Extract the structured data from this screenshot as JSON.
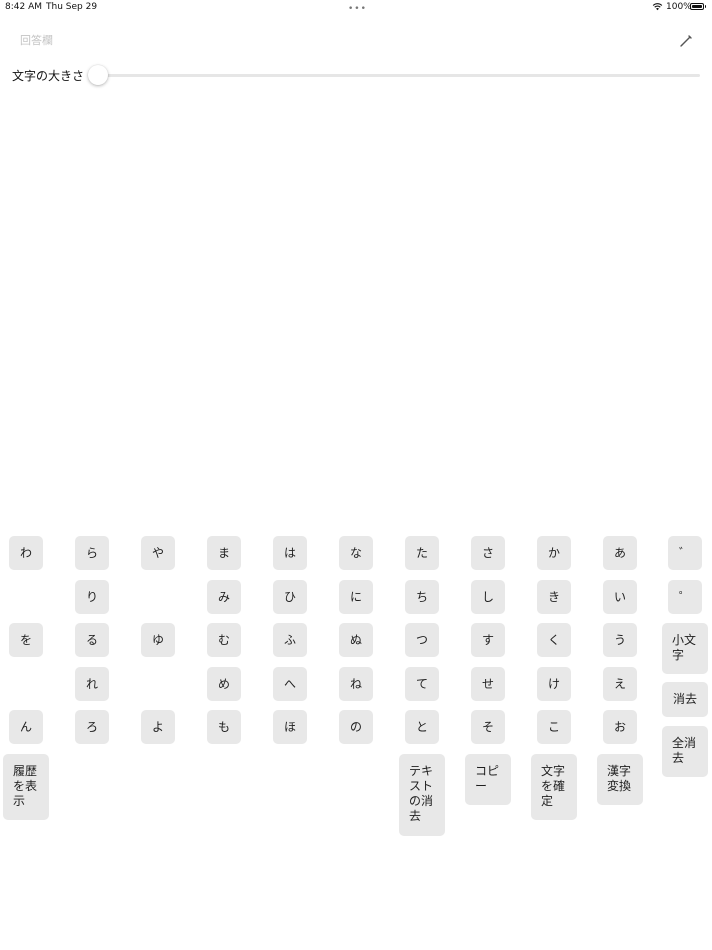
{
  "status_bar": {
    "time": "8:42 AM",
    "date": "Thu Sep 29",
    "battery": "100%"
  },
  "answer": {
    "placeholder": "回答欄",
    "value": ""
  },
  "font_size": {
    "label": "文字の大きさ",
    "value": 0
  },
  "keyboard": {
    "columns": [
      {
        "id": "wa",
        "keys": [
          "わ",
          "",
          "を",
          "",
          "ん"
        ]
      },
      {
        "id": "ra",
        "keys": [
          "ら",
          "り",
          "る",
          "れ",
          "ろ"
        ]
      },
      {
        "id": "ya",
        "keys": [
          "や",
          "",
          "ゆ",
          "",
          "よ"
        ]
      },
      {
        "id": "ma",
        "keys": [
          "ま",
          "み",
          "む",
          "め",
          "も"
        ]
      },
      {
        "id": "ha",
        "keys": [
          "は",
          "ひ",
          "ふ",
          "へ",
          "ほ"
        ]
      },
      {
        "id": "na",
        "keys": [
          "な",
          "に",
          "ぬ",
          "ね",
          "の"
        ]
      },
      {
        "id": "ta",
        "keys": [
          "た",
          "ち",
          "つ",
          "て",
          "と"
        ]
      },
      {
        "id": "sa",
        "keys": [
          "さ",
          "し",
          "す",
          "せ",
          "そ"
        ]
      },
      {
        "id": "ka",
        "keys": [
          "か",
          "き",
          "く",
          "け",
          "こ"
        ]
      },
      {
        "id": "a",
        "keys": [
          "あ",
          "い",
          "う",
          "え",
          "お"
        ]
      }
    ],
    "dakuten": "゛",
    "handakuten": "゜",
    "small_char": "小文字",
    "delete": "消去",
    "clear_all": "全消去",
    "show_history": "履歴を表示",
    "clear_text": "テキストの消去",
    "copy": "コピー",
    "confirm_text": "文字を確定",
    "kanji_convert": "漢字変換"
  }
}
